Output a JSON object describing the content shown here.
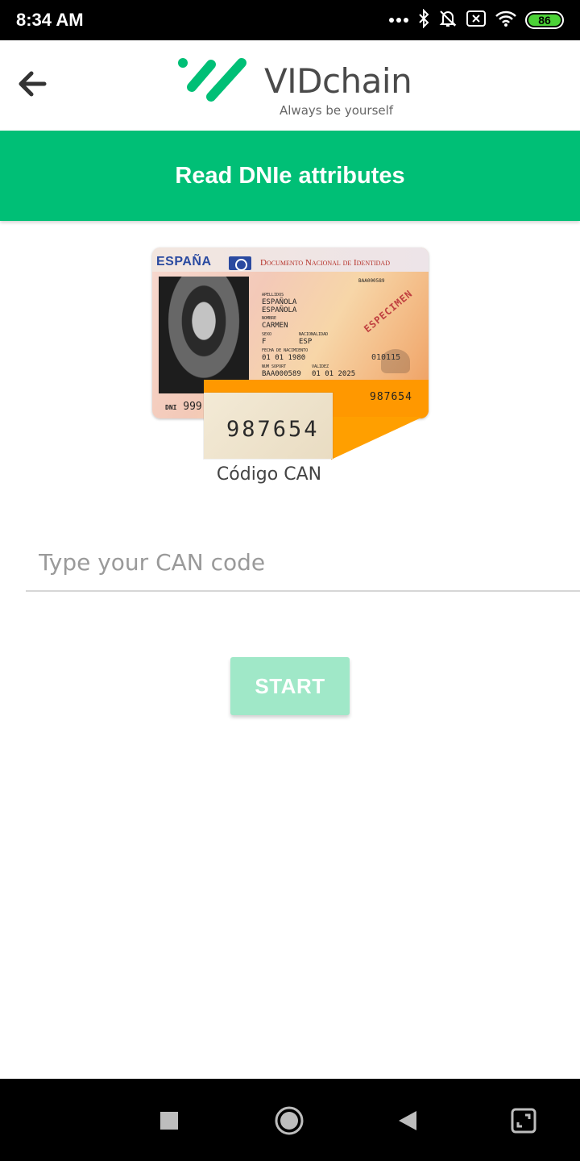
{
  "status_bar": {
    "time": "8:34 AM",
    "battery": "86",
    "icons": [
      "more-dots-icon",
      "bluetooth-icon",
      "notifications-off-icon",
      "no-sim-icon",
      "wifi-icon",
      "battery-icon"
    ]
  },
  "header": {
    "back_icon": "arrow-left-icon",
    "logo_text": "VIDchain",
    "logo_tagline": "Always be yourself",
    "brand_color": "#00bf76"
  },
  "banner": {
    "title": "Read DNIe attributes"
  },
  "id_card": {
    "country": "ESPAÑA",
    "document_title": "Documento Nacional de Identidad",
    "surname_label": "APELLIDOS",
    "surname_1": "ESPAÑOLA",
    "surname_2": "ESPAÑOLA",
    "name_label": "NOMBRE",
    "name": "CARMEN",
    "sex_label": "SEXO",
    "sex": "F",
    "nationality_label": "NACIONALIDAD",
    "nationality": "ESP",
    "birth_label": "FECHA DE NACIMIENTO",
    "birth_date": "01 01 1980",
    "support_label": "NUM SOPORT",
    "support_number": "BAA000589",
    "validity_label": "VALIDEZ",
    "validity_date": "01 01 2025",
    "card_id_small": "BAA000589",
    "specimen": "ESPECIMEN",
    "ghost_number": "010115",
    "dni_prefix": "DNI",
    "dni_number": "999",
    "can_code_card": "987654",
    "can_code_zoom": "987654",
    "accent_orange": "#ff9800"
  },
  "can_caption": "Código CAN",
  "can_input": {
    "placeholder": "Type your CAN code",
    "value": ""
  },
  "start_button": {
    "label": "START",
    "color": "#a0e8c8"
  },
  "nav_bar": {
    "icons": [
      "recents-square-icon",
      "home-circle-icon",
      "back-triangle-icon",
      "screenshot-expand-icon"
    ]
  }
}
